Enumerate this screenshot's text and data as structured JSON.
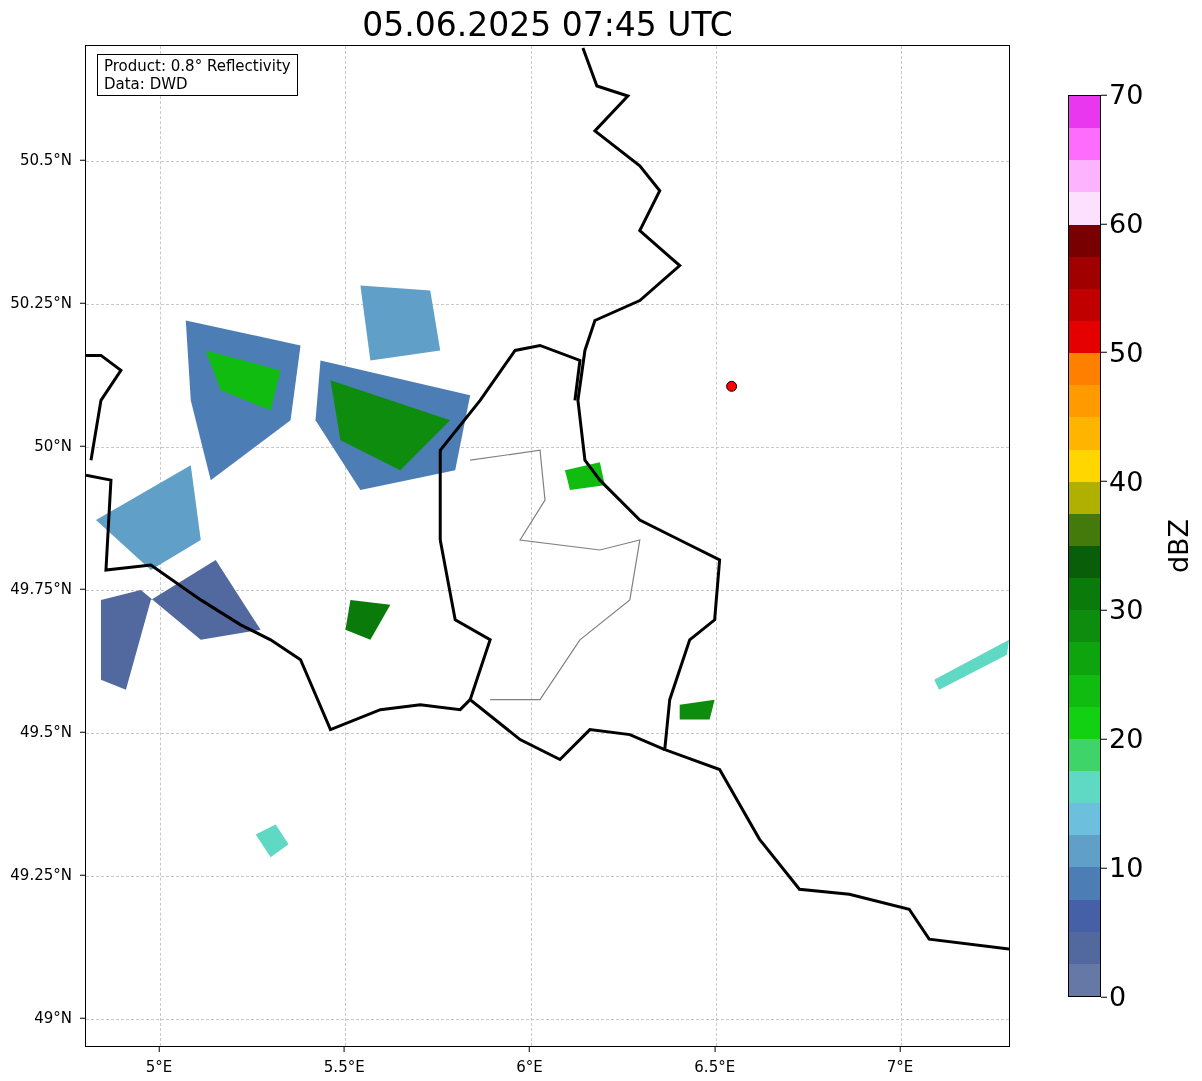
{
  "title": "05.06.2025 07:45 UTC",
  "map": {
    "legend": [
      "Product: 0.8° Reflectivity",
      "Data: DWD"
    ],
    "yticks": [
      "50.5°N",
      "50.25°N",
      "50°N",
      "49.75°N",
      "49.5°N",
      "49.25°N",
      "49°N"
    ],
    "xticks": [
      "5°E",
      "5.5°E",
      "6°E",
      "6.5°E",
      "7°E"
    ]
  },
  "colorbar": {
    "label": "dBZ",
    "ticks": [
      "70",
      "60",
      "50",
      "40",
      "30",
      "20",
      "10",
      "0"
    ],
    "bins": [
      {
        "color": "#e837ee"
      },
      {
        "color": "#fd6cfd"
      },
      {
        "color": "#fdb3fd"
      },
      {
        "color": "#fde0fd"
      },
      {
        "color": "#780000"
      },
      {
        "color": "#a00000"
      },
      {
        "color": "#c00000"
      },
      {
        "color": "#e40000"
      },
      {
        "color": "#ff7f00"
      },
      {
        "color": "#ff9b00"
      },
      {
        "color": "#ffb500"
      },
      {
        "color": "#ffd600"
      },
      {
        "color": "#b0b000"
      },
      {
        "color": "#447a0b"
      },
      {
        "color": "#095e09"
      },
      {
        "color": "#0a7a0a"
      },
      {
        "color": "#0e8c0e"
      },
      {
        "color": "#0ea40e"
      },
      {
        "color": "#10bc10"
      },
      {
        "color": "#12d012"
      },
      {
        "color": "#3ed46a"
      },
      {
        "color": "#5fd8c4"
      },
      {
        "color": "#6cc0dd"
      },
      {
        "color": "#5f9fc8"
      },
      {
        "color": "#4d7db5"
      },
      {
        "color": "#4660a7"
      },
      {
        "color": "#52699f"
      },
      {
        "color": "#6679a6"
      }
    ]
  }
}
